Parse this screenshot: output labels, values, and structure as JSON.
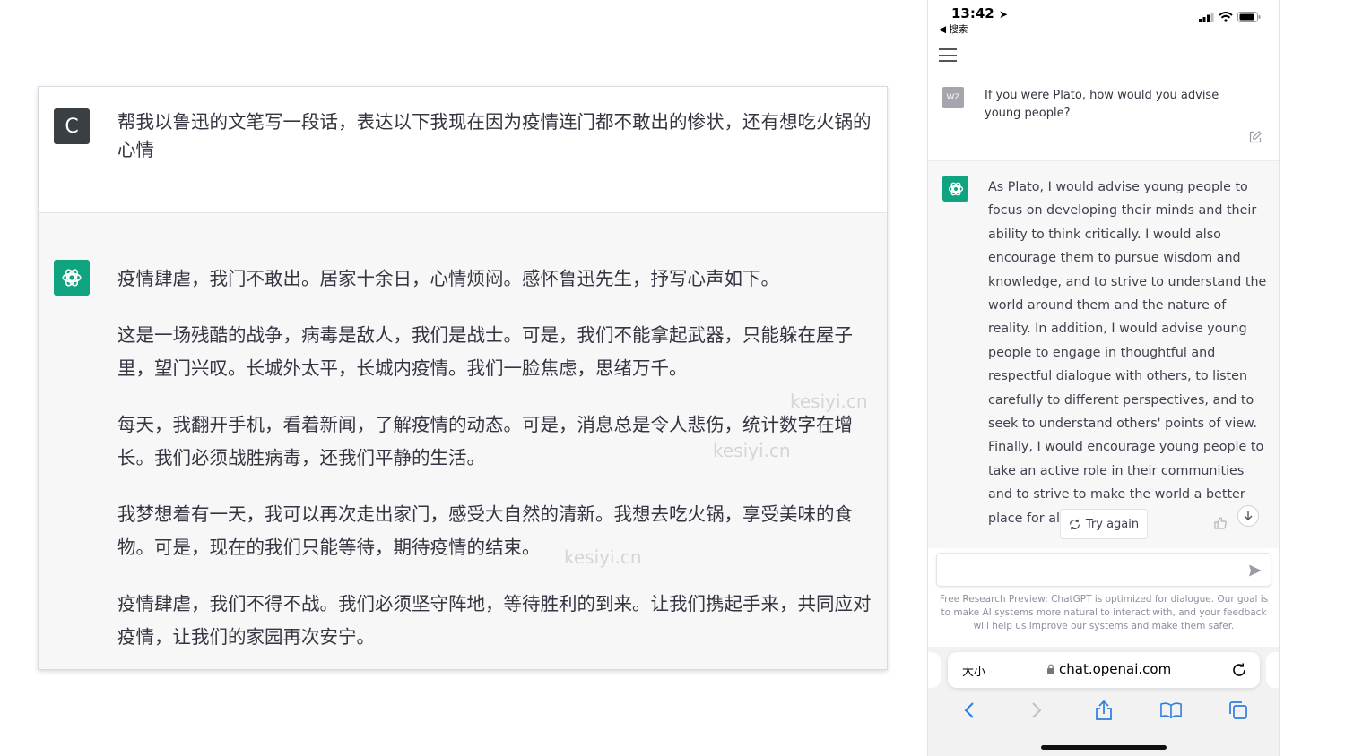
{
  "left_chat": {
    "user_avatar": "C",
    "user_prompt": "帮我以鲁迅的文笔写一段话，表达以下我现在因为疫情连门都不敢出的惨状，还有想吃火锅的心情",
    "bot_paragraphs": [
      "疫情肆虐，我门不敢出。居家十余日，心情烦闷。感怀鲁迅先生，抒写心声如下。",
      "这是一场残酷的战争，病毒是敌人，我们是战士。可是，我们不能拿起武器，只能躲在屋子里，望门兴叹。长城外太平，长城内疫情。我们一脸焦虑，思绪万千。",
      "每天，我翻开手机，看着新闻，了解疫情的动态。可是，消息总是令人悲伤，统计数字在增长。我们必须战胜病毒，还我们平静的生活。",
      "我梦想着有一天，我可以再次走出家门，感受大自然的清新。我想去吃火锅，享受美味的食物。可是，现在的我们只能等待，期待疫情的结束。",
      "疫情肆虐，我们不得不战。我们必须坚守阵地，等待胜利的到来。让我们携起手来，共同应对疫情，让我们的家园再次安宁。"
    ],
    "watermark": "kesiyi.cn"
  },
  "phone": {
    "status": {
      "time": "13:42",
      "back_label": "◀ 搜索"
    },
    "user_avatar": "WZ",
    "user_prompt": "If you were Plato, how would you advise young people?",
    "bot_response": "As Plato, I would advise young people to focus on developing their minds and their ability to think critically. I would also encourage them to pursue wisdom and knowledge, and to strive to understand the world around them and the nature of reality. In addition, I would advise young people to engage in thoughtful and respectful dialogue with others, to listen carefully to different perspectives, and to seek to understand others' points of view. Finally, I would encourage young people to take an active role in their communities and to strive to make the world a better place for all.",
    "try_again_label": "Try again",
    "disclaimer": "Free Research Preview: ChatGPT is optimized for dialogue. Our goal is to make AI systems more natural to interact with, and your feedback will help us improve our systems and make them safer.",
    "safari": {
      "text_size_label": "大小",
      "url": "chat.openai.com"
    }
  },
  "colors": {
    "accent": "#10a37f",
    "bot_bg": "#f7f7f8",
    "text": "#343541"
  }
}
